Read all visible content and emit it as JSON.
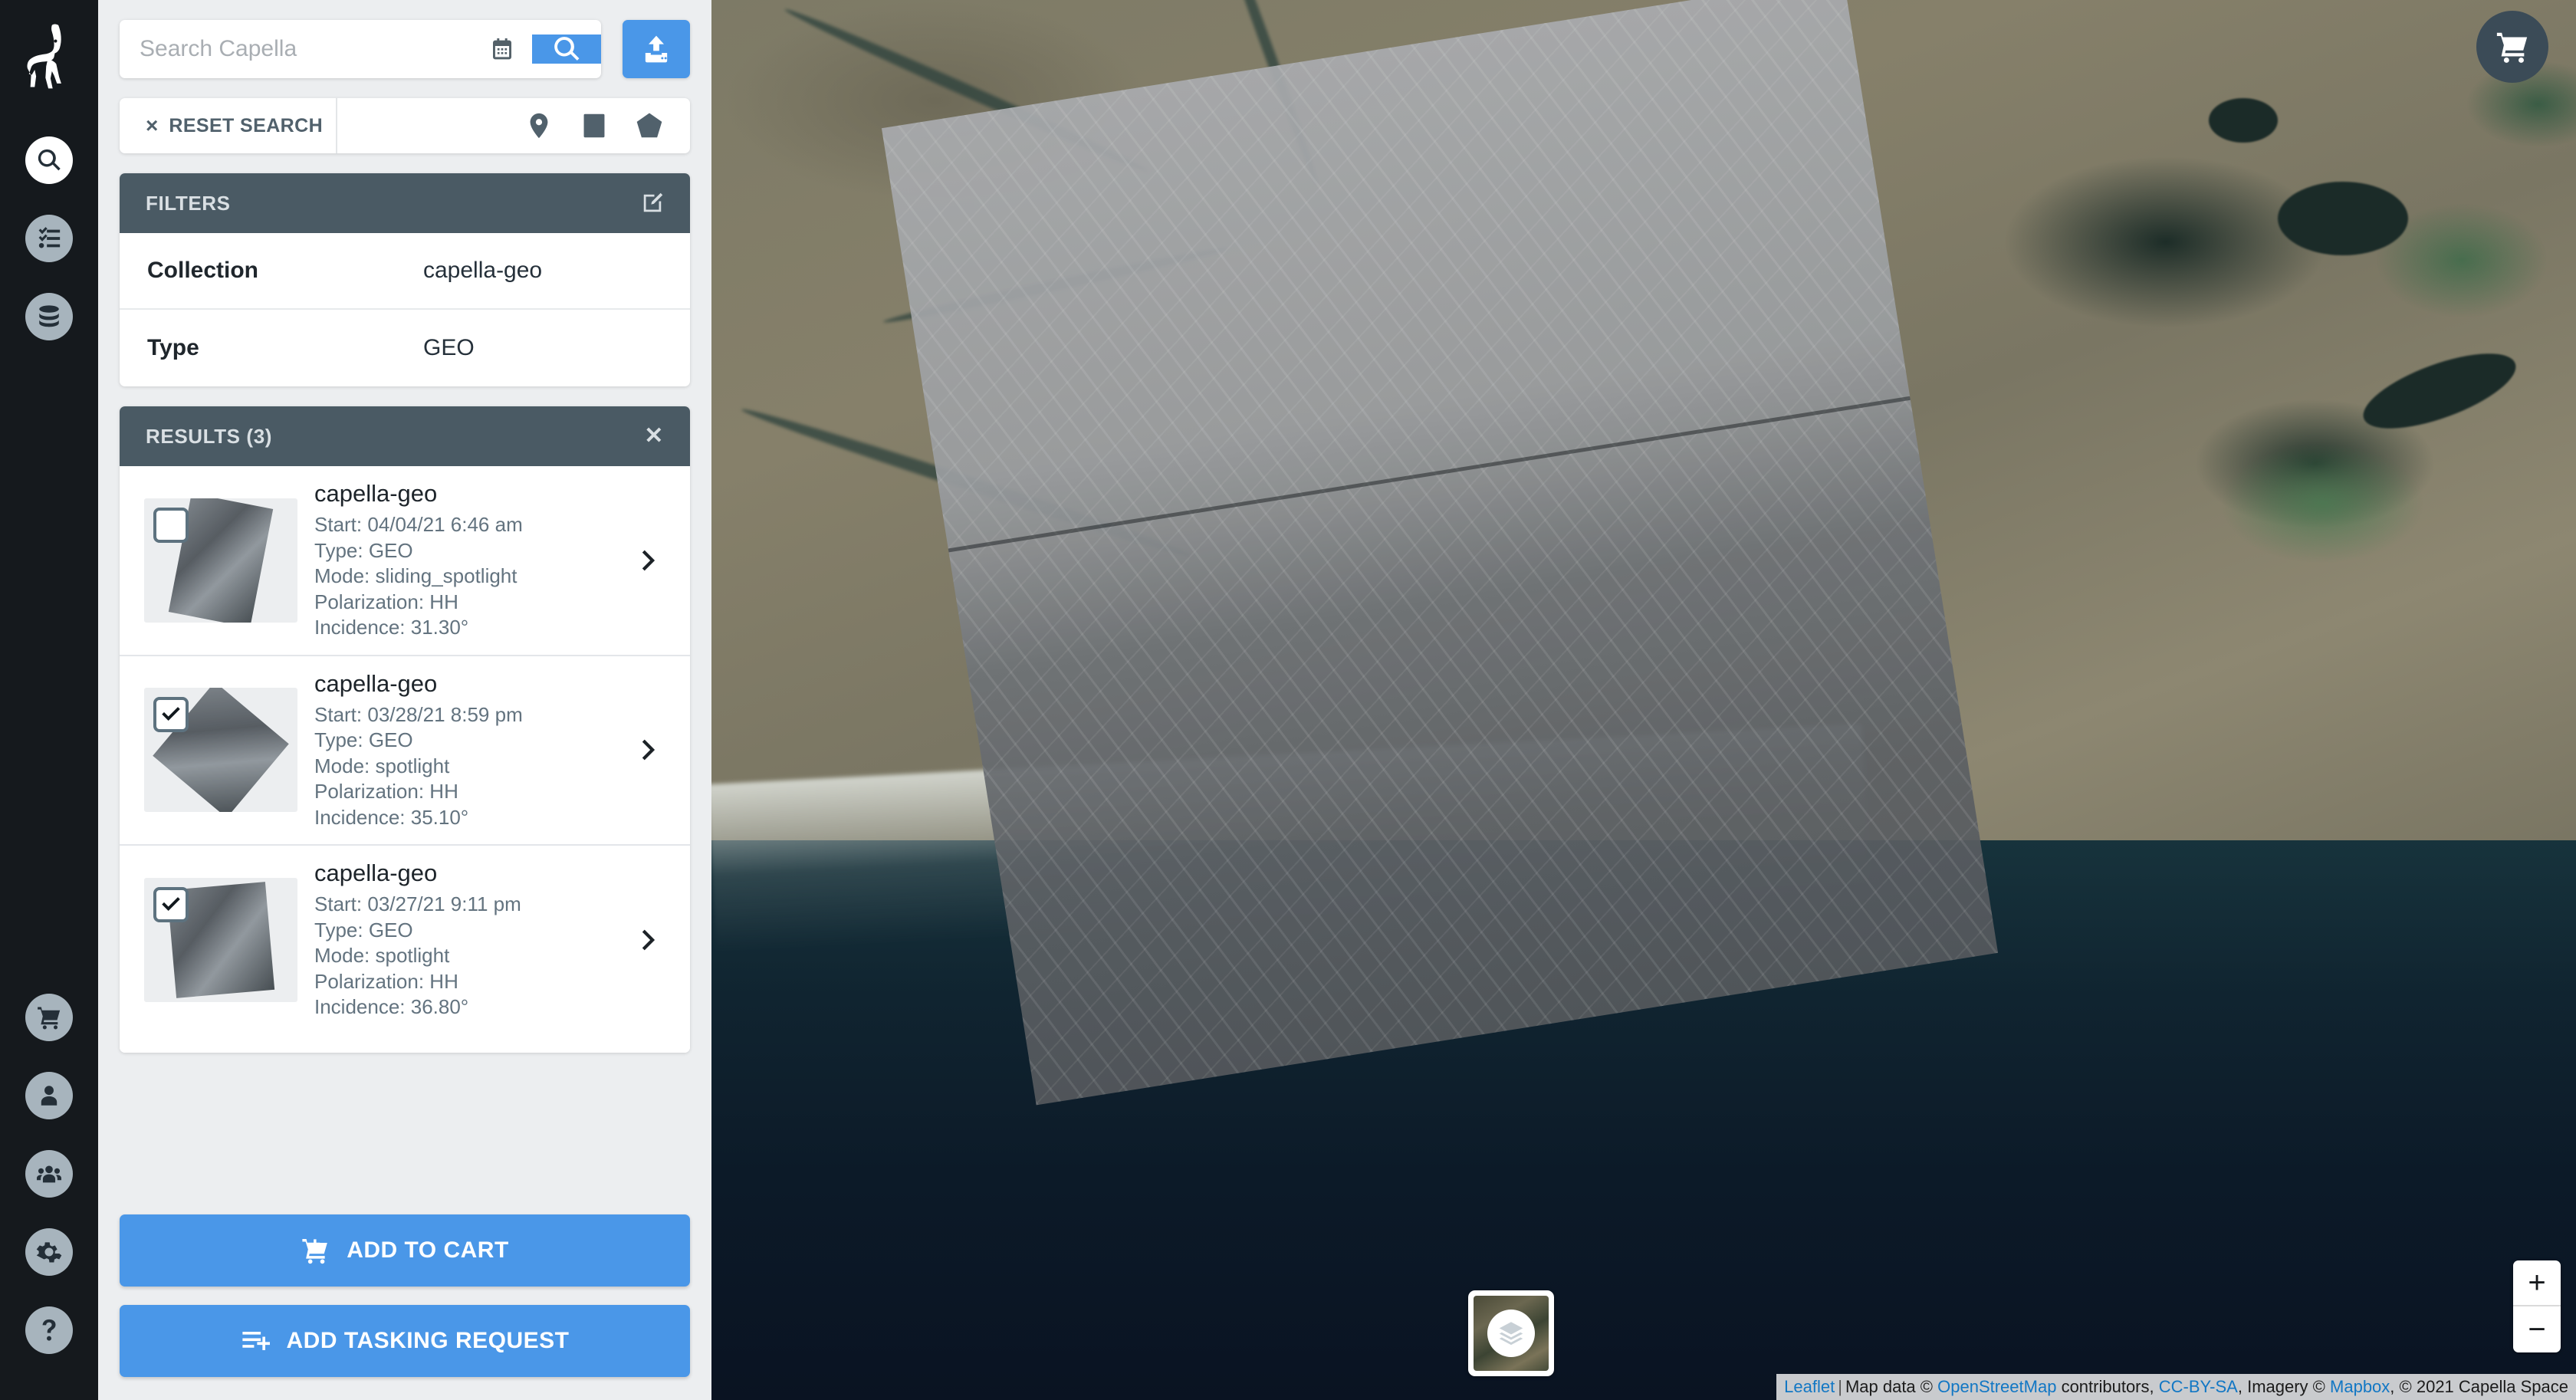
{
  "rail": {
    "logo": "capella-ibex-logo",
    "top_items": [
      {
        "name": "search",
        "icon": "search-icon",
        "active": true
      },
      {
        "name": "tasks",
        "icon": "checklist-icon",
        "active": false
      },
      {
        "name": "data",
        "icon": "database-icon",
        "active": false
      }
    ],
    "bottom_items": [
      {
        "name": "cart",
        "icon": "cart-icon"
      },
      {
        "name": "account",
        "icon": "user-icon"
      },
      {
        "name": "organization",
        "icon": "users-icon"
      },
      {
        "name": "settings",
        "icon": "gear-icon"
      },
      {
        "name": "help",
        "icon": "question-mark-icon"
      }
    ]
  },
  "search": {
    "placeholder": "Search Capella",
    "value": "",
    "calendar_icon": "calendar-icon",
    "submit_icon": "search-icon",
    "upload_icon": "upload-icon"
  },
  "toolbar": {
    "reset_x": "×",
    "reset_label": "RESET SEARCH",
    "tools": [
      {
        "name": "marker-tool",
        "icon": "map-pin-icon"
      },
      {
        "name": "rectangle-tool",
        "icon": "rectangle-icon"
      },
      {
        "name": "polygon-tool",
        "icon": "polygon-icon"
      }
    ]
  },
  "filters": {
    "title": "FILTERS",
    "edit_icon": "edit-pencil-icon",
    "rows": [
      {
        "key": "Collection",
        "value": "capella-geo"
      },
      {
        "key": "Type",
        "value": "GEO"
      }
    ]
  },
  "results": {
    "title": "RESULTS (3)",
    "close": "✕",
    "items": [
      {
        "title": "capella-geo",
        "start": "Start: 04/04/21 6:46 am",
        "type": "Type: GEO",
        "mode": "Mode: sliding_spotlight",
        "polarization": "Polarization: HH",
        "incidence": "Incidence: 31.30°",
        "checked": false
      },
      {
        "title": "capella-geo",
        "start": "Start: 03/28/21 8:59 pm",
        "type": "Type: GEO",
        "mode": "Mode: spotlight",
        "polarization": "Polarization: HH",
        "incidence": "Incidence: 35.10°",
        "checked": true
      },
      {
        "title": "capella-geo",
        "start": "Start: 03/27/21 9:11 pm",
        "type": "Type: GEO",
        "mode": "Mode: spotlight",
        "polarization": "Polarization: HH",
        "incidence": "Incidence: 36.80°",
        "checked": true
      }
    ]
  },
  "actions": {
    "add_to_cart": "ADD TO CART",
    "add_tasking_request": "ADD TASKING REQUEST",
    "cart_icon": "cart-plus-icon",
    "tasking_icon": "list-plus-icon"
  },
  "map": {
    "cart_fab_icon": "cart-icon",
    "layers_icon": "layers-icon",
    "zoom_in": "+",
    "zoom_out": "−",
    "attribution": {
      "leaflet": "Leaflet",
      "separator": "|",
      "map_data": "Map data ©",
      "osm": "OpenStreetMap",
      "contributors": "contributors,",
      "license": "CC-BY-SA",
      "imagery": ", Imagery ©",
      "mapbox": "Mapbox",
      "copyright": ", © 2021 Capella Space"
    }
  },
  "colors": {
    "accent_blue": "#4a97e8",
    "header_slate": "#4a5a64",
    "rail_dark": "#15191d",
    "panel_bg": "#eceef0",
    "meta_text": "#63737f"
  }
}
